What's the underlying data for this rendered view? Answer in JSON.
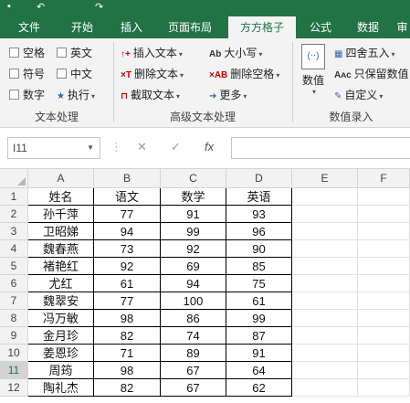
{
  "quick_access": {
    "save_icon": "save-icon",
    "undo_icon": "undo-icon",
    "redo_icon": "redo-icon"
  },
  "tabs": [
    {
      "label": "文件"
    },
    {
      "label": "开始"
    },
    {
      "label": "插入"
    },
    {
      "label": "页面布局"
    },
    {
      "label": "方方格子",
      "active": true
    },
    {
      "label": "公式"
    },
    {
      "label": "数据"
    },
    {
      "label": "审"
    }
  ],
  "ribbon": {
    "text_processing": {
      "label": "文本处理",
      "checkboxes": [
        "空格",
        "英文",
        "符号",
        "中文",
        "数字"
      ],
      "execute": "执行"
    },
    "advanced_text": {
      "label": "高级文本处理",
      "items": [
        "插入文本",
        "删除文本",
        "截取文本",
        "大小写",
        "删除空格",
        "更多"
      ]
    },
    "numeric_entry": {
      "label": "数值录入",
      "big_button": "数值",
      "items": [
        "四舍五入",
        "只保留数值",
        "自定义"
      ]
    }
  },
  "formula_bar": {
    "name_box": "I11",
    "formula": "",
    "fx": "fx"
  },
  "columns": [
    "A",
    "B",
    "C",
    "D",
    "E",
    "F"
  ],
  "rows": [
    "1",
    "2",
    "3",
    "4",
    "5",
    "6",
    "7",
    "8",
    "9",
    "10",
    "11",
    "12"
  ],
  "selected_row": "11",
  "table": [
    [
      "姓名",
      "语文",
      "数学",
      "英语"
    ],
    [
      "孙千萍",
      "77",
      "91",
      "93"
    ],
    [
      "卫昭娣",
      "94",
      "99",
      "96"
    ],
    [
      "魏春燕",
      "73",
      "92",
      "90"
    ],
    [
      "褚艳红",
      "92",
      "69",
      "85"
    ],
    [
      "尤红",
      "61",
      "94",
      "75"
    ],
    [
      "魏翠安",
      "77",
      "100",
      "61"
    ],
    [
      "冯万敏",
      "98",
      "86",
      "99"
    ],
    [
      "金月珍",
      "82",
      "74",
      "87"
    ],
    [
      "姜恩珍",
      "71",
      "89",
      "91"
    ],
    [
      "周筠",
      "98",
      "67",
      "64"
    ],
    [
      "陶礼杰",
      "82",
      "67",
      "62"
    ]
  ],
  "colors": {
    "brand": "#217346",
    "ribbon_bg": "#f3f3f3",
    "header_bg": "#f2f2f2"
  }
}
